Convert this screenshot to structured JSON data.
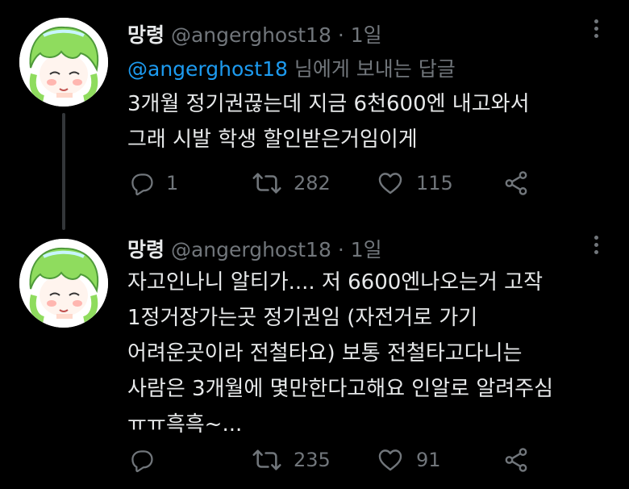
{
  "tweets": [
    {
      "name": "망령",
      "handle": "@angerghost18",
      "separator": "·",
      "time": "1일",
      "reply_to": {
        "mention": "@angerghost18",
        "suffix": " 님에게 보내는 답글"
      },
      "lines": [
        "3개월 정기권끊는데 지금 6천600엔 내고와서",
        "그래 시발 학생 할인받은거임이게"
      ],
      "replies": "1",
      "retweets": "282",
      "likes": "115"
    },
    {
      "name": "망령",
      "handle": "@angerghost18",
      "separator": "·",
      "time": "1일",
      "lines": [
        "자고인나니 알티가.... 저 6600엔나오는거 고작",
        "1정거장가는곳 정기권임 (자전거로 가기",
        "어려운곳이라 전철타요) 보통 전철타고다니는",
        "사람은 3개월에 몇만한다고해요 인알로 알려주심",
        "ㅠㅠ흑흑~..."
      ],
      "replies": "",
      "retweets": "235",
      "likes": "91"
    }
  ],
  "icons": {
    "reply": "reply-icon",
    "retweet": "retweet-icon",
    "like": "heart-icon",
    "share": "share-icon",
    "more": "more-options-icon"
  },
  "colors": {
    "background": "#000000",
    "text": "#e7e9ea",
    "muted": "#71767b",
    "mention": "#1d9bf0",
    "avatar_hair": "#8fdc5e"
  }
}
